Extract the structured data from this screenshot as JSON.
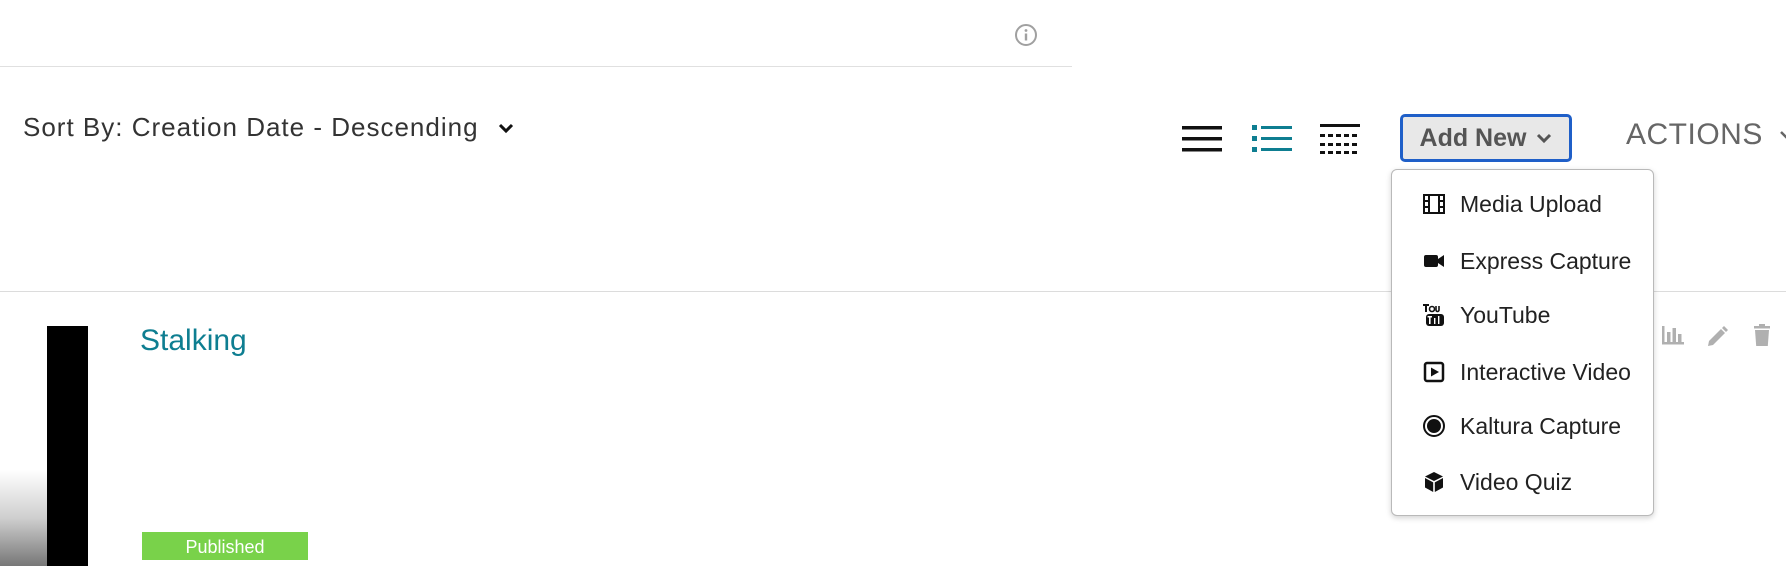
{
  "header": {
    "info_icon": "info-icon"
  },
  "toolbar": {
    "sort_label": "Sort By: Creation Date - Descending",
    "views": [
      "detailed-view-icon",
      "compact-list-view-icon",
      "table-view-icon"
    ],
    "active_view": "compact-list-view-icon",
    "add_new_label": "Add New",
    "actions_label": "ACTIONS"
  },
  "add_new_menu": {
    "items": [
      {
        "label": "Media Upload",
        "icon": "film-icon"
      },
      {
        "label": "Express Capture",
        "icon": "video-camera-icon"
      },
      {
        "label": "YouTube",
        "icon": "youtube-icon"
      },
      {
        "label": "Interactive Video",
        "icon": "play-square-icon"
      },
      {
        "label": "Kaltura Capture",
        "icon": "record-circle-icon"
      },
      {
        "label": "Video Quiz",
        "icon": "cube-icon"
      }
    ]
  },
  "entry": {
    "title": "Stalking",
    "status": "Published",
    "row_actions": [
      "stats-icon",
      "edit-icon",
      "delete-icon"
    ]
  },
  "colors": {
    "accent": "#0e7e91",
    "focus_border": "#1f5fc8",
    "published": "#79d24a"
  }
}
